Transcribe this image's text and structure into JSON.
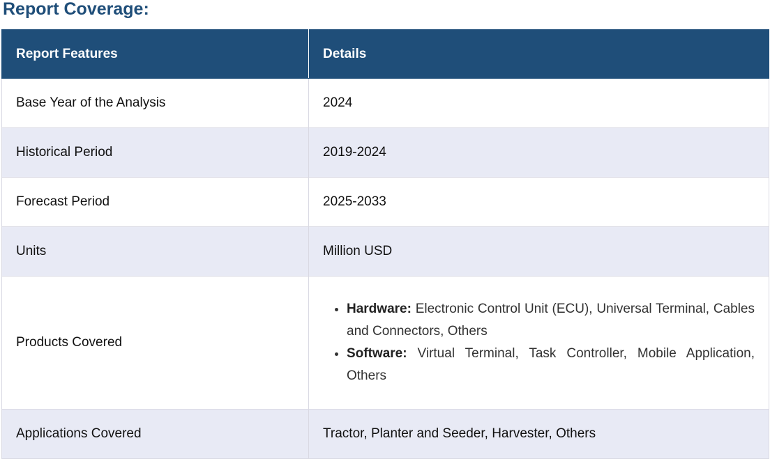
{
  "heading": "Report Coverage:",
  "table": {
    "headers": [
      "Report Features",
      "Details"
    ],
    "rows": [
      {
        "feature": "Base Year of the Analysis",
        "details": "2024"
      },
      {
        "feature": "Historical Period",
        "details": "2019-2024"
      },
      {
        "feature": "Forecast Period",
        "details": "2025-2033"
      },
      {
        "feature": "Units",
        "details": "Million USD"
      },
      {
        "feature": "Products Covered",
        "items": [
          {
            "label": "Hardware:",
            "text": " Electronic Control Unit (ECU), Universal Terminal, Cables and Connectors, Others"
          },
          {
            "label": "Software:",
            "text": " Virtual Terminal, Task Controller, Mobile Application, Others"
          }
        ]
      },
      {
        "feature": "Applications Covered",
        "details": "Tractor, Planter and Seeder, Harvester, Others"
      }
    ]
  },
  "colors": {
    "header_bg": "#1f4e79",
    "alt_row_bg": "#e8eaf5",
    "heading_text": "#1f4e79"
  }
}
